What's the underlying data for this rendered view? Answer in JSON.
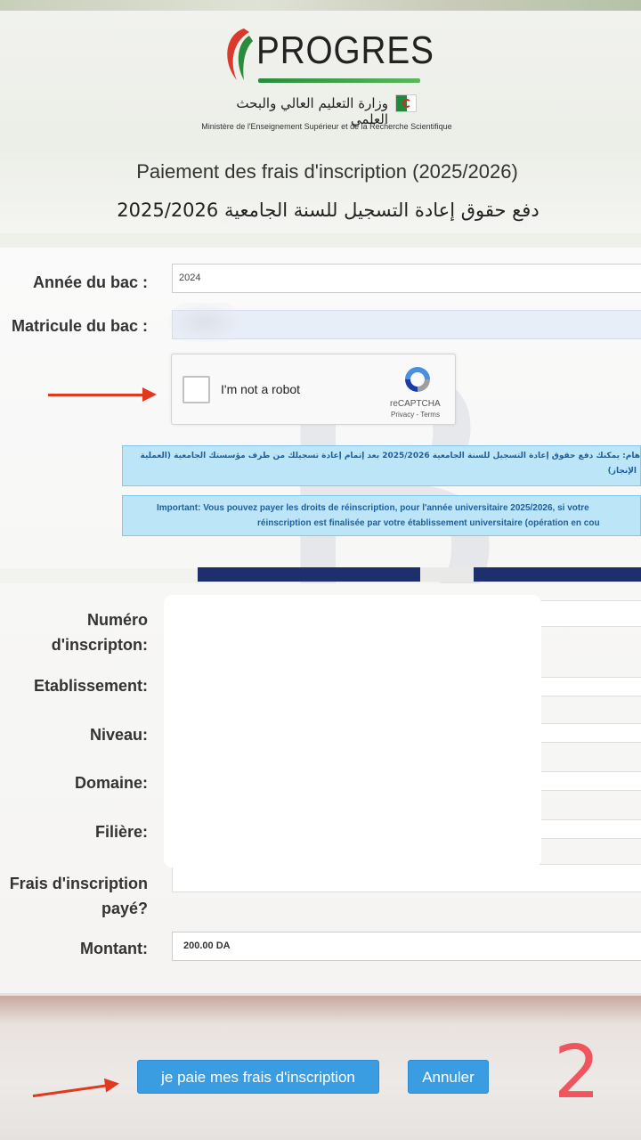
{
  "header": {
    "logo_text": "PROGRES",
    "ministry_ar": "وزارة التعليم العالي والبحث العلمي",
    "ministry_fr": "Ministère de l'Enseignement Supérieur et de la Recherche Scientifique",
    "title_fr": "Paiement des frais d'inscription (2025/2026)",
    "title_ar": "دفع حقوق إعادة التسجيل للسنة الجامعية 2025/2026"
  },
  "form": {
    "annee_label": "Année du bac :",
    "annee_value": "2024",
    "matricule_label": "Matricule du bac :",
    "matricule_value": ""
  },
  "captcha": {
    "label": "I'm not a robot",
    "brand": "reCAPTCHA",
    "terms": "Privacy - Terms"
  },
  "alerts": {
    "ar_line1": "هام: يمكنك دفع حقوق إعادة التسجيل للسنة الجامعية 2025/2026 بعد إتمام إعادة تسجيلك من طرف مؤسستك الجامعية (العملية",
    "ar_line2": "الإنجاز)",
    "fr_line1": "Important: Vous pouvez payer les droits de réinscription, pour l'année universitaire 2025/2026, si votre",
    "fr_line2": "réinscription est finalisée par votre établissement universitaire (opération en cou"
  },
  "details": {
    "numero_label_1": "Numéro",
    "numero_label_2": "d'inscripton:",
    "etablissement_label": "Etablissement:",
    "niveau_label": "Niveau:",
    "domaine_label": "Domaine:",
    "filiere_label": "Filière:",
    "frais_label_1": "Frais d'inscription",
    "frais_label_2": "payé?",
    "montant_label": "Montant:",
    "montant_value": "200.00 DA"
  },
  "actions": {
    "pay_label": "je paie mes frais d'inscription",
    "cancel_label": "Annuler",
    "step_number": "2"
  },
  "colors": {
    "button": "#3b9de1",
    "alert_bg": "#bde5f8",
    "annotation": "#e0391e",
    "step_number": "#f0545c"
  }
}
